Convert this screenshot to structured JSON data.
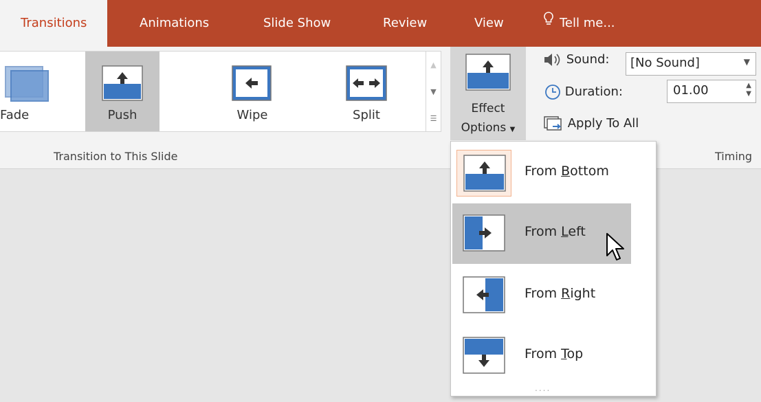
{
  "tabs": [
    {
      "label": "Transitions",
      "active": true
    },
    {
      "label": "Animations",
      "active": false
    },
    {
      "label": "Slide Show",
      "active": false
    },
    {
      "label": "Review",
      "active": false
    },
    {
      "label": "View",
      "active": false
    }
  ],
  "tell_me": "Tell me...",
  "gallery": {
    "items": [
      {
        "label": "Fade",
        "icon": "fade-transition-icon",
        "selected": false
      },
      {
        "label": "Push",
        "icon": "push-transition-icon",
        "selected": true
      },
      {
        "label": "Wipe",
        "icon": "wipe-transition-icon",
        "selected": false
      },
      {
        "label": "Split",
        "icon": "split-transition-icon",
        "selected": false
      }
    ],
    "group_label": "Transition to This Slide"
  },
  "effect_options": {
    "line1": "Effect",
    "line2": "Options"
  },
  "timing": {
    "sound_label": "Sound:",
    "sound_value": "[No Sound]",
    "duration_label": "Duration:",
    "duration_value": "01.00",
    "apply_all_label": "Apply To All",
    "group_label": "Timing"
  },
  "menu": {
    "items": [
      {
        "pre": "From ",
        "key": "B",
        "post": "ottom",
        "icon": "push-from-bottom-icon",
        "checked": true
      },
      {
        "pre": "From ",
        "key": "L",
        "post": "eft",
        "icon": "push-from-left-icon",
        "hovered": true
      },
      {
        "pre": "From ",
        "key": "R",
        "post": "ight",
        "icon": "push-from-right-icon"
      },
      {
        "pre": "From ",
        "key": "T",
        "post": "op",
        "icon": "push-from-top-icon"
      }
    ]
  },
  "colors": {
    "tab_bar": "#b7472a",
    "active_tab_text": "#c43e1c",
    "icon_blue": "#3b77c1",
    "hover_gray": "#c6c6c6",
    "checked_bg": "#fcece2"
  }
}
